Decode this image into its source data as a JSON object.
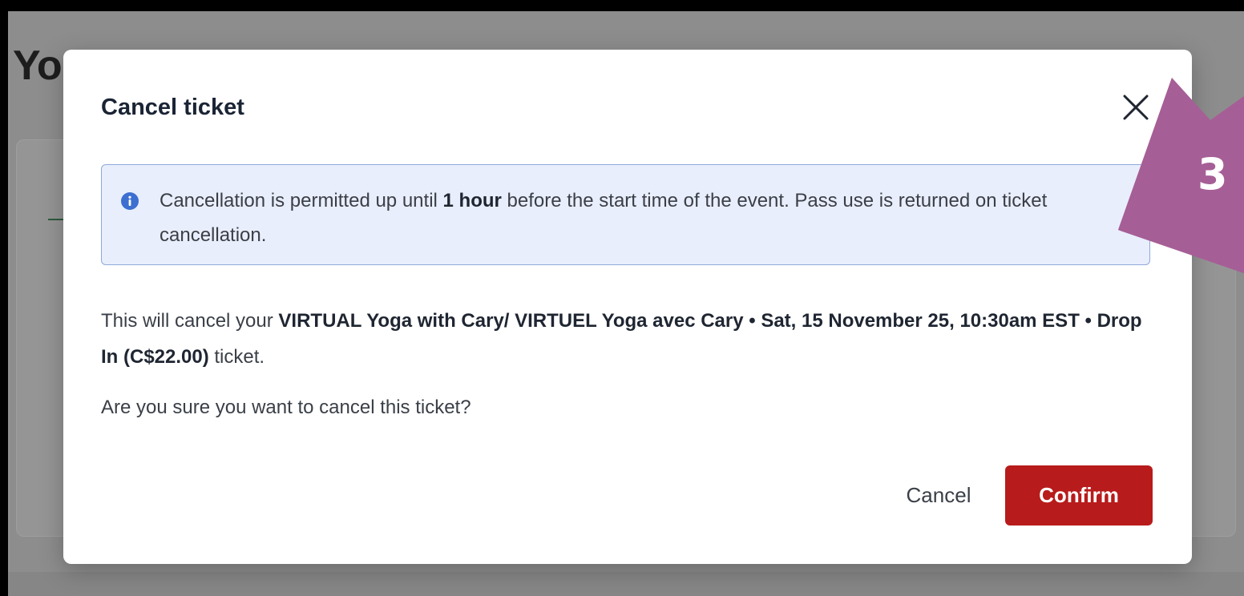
{
  "background": {
    "page_title": "Yo"
  },
  "modal": {
    "title": "Cancel ticket",
    "close_icon": "close-x-icon",
    "info": {
      "icon": "info-icon",
      "text_before": "Cancellation is permitted up until ",
      "text_bold": "1 hour",
      "text_after": " before the start time of the event. Pass use is returned on ticket cancellation."
    },
    "body": {
      "prefix": "This will cancel your ",
      "ticket_description": "VIRTUAL Yoga with Cary/ VIRTUEL Yoga avec Cary • Sat, 15 November 25, 10:30am EST • Drop In (C$22.00)",
      "suffix": " ticket."
    },
    "question": "Are you sure you want to cancel this ticket?",
    "buttons": {
      "cancel_label": "Cancel",
      "confirm_label": "Confirm"
    }
  },
  "annotation": {
    "step_number": "3",
    "color": "#a65e96"
  },
  "colors": {
    "confirm_button": "#b81b1b",
    "info_background": "#e9eefc",
    "info_border": "#8fa9d9",
    "info_icon": "#3d6fd1"
  }
}
